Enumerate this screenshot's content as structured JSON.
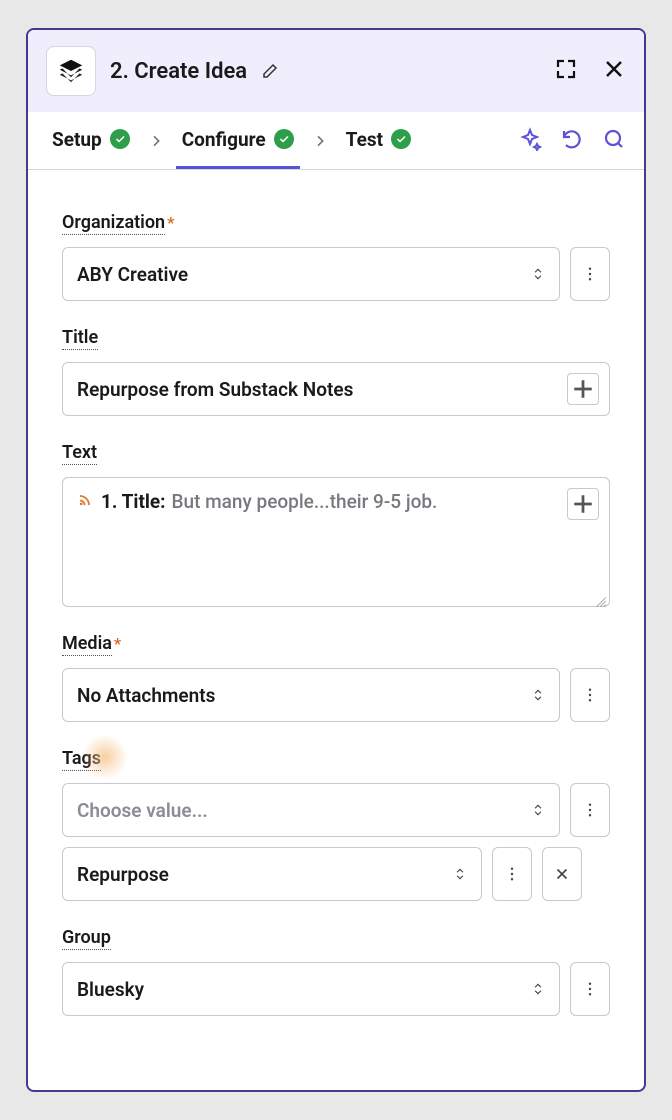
{
  "header": {
    "title": "2. Create Idea"
  },
  "steps": {
    "setup": "Setup",
    "configure": "Configure",
    "test": "Test"
  },
  "fields": {
    "organization": {
      "label": "Organization",
      "value": "ABY Creative"
    },
    "title": {
      "label": "Title",
      "value": "Repurpose from Substack Notes"
    },
    "text": {
      "label": "Text",
      "pill_prefix": "1. Title:",
      "pill_value": "But many people...their 9-5 job."
    },
    "media": {
      "label": "Media",
      "value": "No Attachments"
    },
    "tags": {
      "label": "Tags",
      "placeholder": "Choose value...",
      "selected": "Repurpose"
    },
    "group": {
      "label": "Group",
      "value": "Bluesky"
    }
  }
}
